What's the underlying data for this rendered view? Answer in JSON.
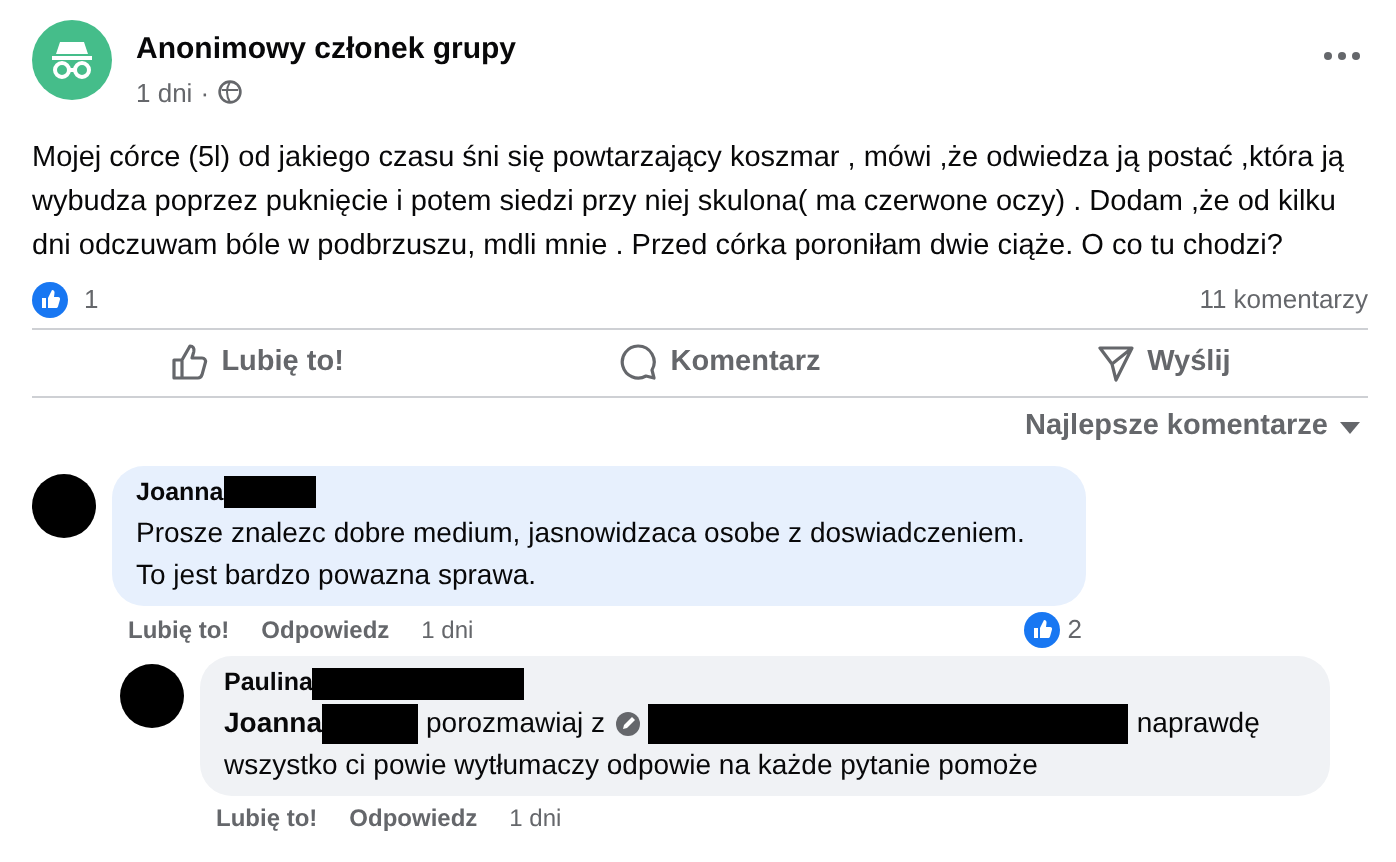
{
  "post": {
    "author": "Anonimowy członek grupy",
    "time": "1 dni",
    "separator": "·",
    "text": "Mojej córce (5l) od jakiego czasu śni się powtarzający koszmar , mówi ,że odwiedza ją postać ,która ją wybudza poprzez puknięcie i potem siedzi przy niej skulona( ma czerwone oczy) . Dodam ,że od kilku dni odczuwam bóle w podbrzuszu, mdli mnie . Przed córka poroniłam dwie ciąże. O co tu chodzi?",
    "like_count": "1",
    "comment_count": "11 komentarzy"
  },
  "actions": [
    {
      "kind": "like",
      "label": "Lubię to!"
    },
    {
      "kind": "comment",
      "label": "Komentarz"
    },
    {
      "kind": "send",
      "label": "Wyślij"
    }
  ],
  "sort_label": "Najlepsze komentarze",
  "comments": [
    {
      "author": "Joanna",
      "color": "#e7f0fd",
      "segments": [
        {
          "kind": "text",
          "text": "Prosze znalezc dobre medium, jasnowidzaca osobe z doswiadczeniem."
        },
        {
          "kind": "text",
          "text": "To jest bardzo powazna sprawa."
        }
      ],
      "like": "Lubię to!",
      "reply": "Odpowiedz",
      "time": "1 dni",
      "reaction_count": "2",
      "children": [
        {
          "author": "Paulina",
          "color": "#f0f2f5",
          "segments": [
            {
              "kind": "mention",
              "text": "Joanna"
            },
            {
              "kind": "redacted"
            },
            {
              "kind": "text",
              "text": "porozmawiaj z"
            },
            {
              "kind": "page-mention"
            },
            {
              "kind": "redacted-long"
            },
            {
              "kind": "text",
              "text": "naprawdę"
            },
            {
              "kind": "text",
              "text": "wszystko ci powie wytłumaczy odpowie na każde pytanie pomoże"
            }
          ],
          "like": "Lubię to!",
          "reply": "Odpowiedz",
          "time": "1 dni"
        }
      ]
    }
  ]
}
